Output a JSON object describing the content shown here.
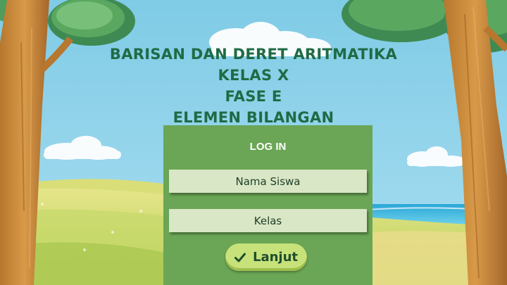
{
  "title": {
    "line1": "BARISAN DAN DERET ARITMATIKA",
    "line2": "KELAS X",
    "line3": "FASE E",
    "line4": "ELEMEN BILANGAN"
  },
  "login": {
    "heading": "LOG IN",
    "name_placeholder": "Nama Siswa",
    "class_placeholder": "Kelas",
    "submit_label": "Lanjut",
    "submit_icon": "check-icon"
  },
  "colors": {
    "panel": "#6aa655",
    "title_text": "#1f6b45",
    "field_bg": "#d9e7c6",
    "button_bg": "#c7e27a"
  }
}
